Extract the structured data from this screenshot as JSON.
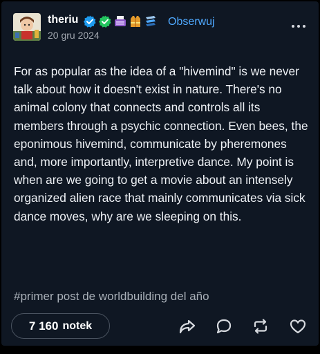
{
  "post": {
    "author": "theriu",
    "date": "20 gru 2024",
    "follow_label": "Obserwuj",
    "body": "For as popular as the idea of a \"hivemind\" is we never talk about how it doesn't exist in nature. There's no animal colony that connects and controls all its members through a psychic connection. Even bees, the eponimous hivemind, communicate by pheremones and, more importantly, interpretive dance. My point is when are we going to get a movie about an intensely organized alien race that mainly communicates via sick dance moves, why are we sleeping on this.",
    "tag": "#primer post de worldbuilding del año",
    "notes_count": "7 160",
    "notes_label": "notek"
  },
  "icons": {
    "badges": [
      "verified-blue-icon",
      "verified-green-icon",
      "typewriter-icon",
      "vest-icon",
      "stack-icon"
    ],
    "actions": [
      "share-icon",
      "reply-icon",
      "reblog-icon",
      "like-icon"
    ],
    "menu": "more-options-icon"
  },
  "colors": {
    "background": "#0f1723",
    "accent_link": "#4fa9ff",
    "verified_blue": "#1d9bf0",
    "verified_green": "#22c55e"
  }
}
